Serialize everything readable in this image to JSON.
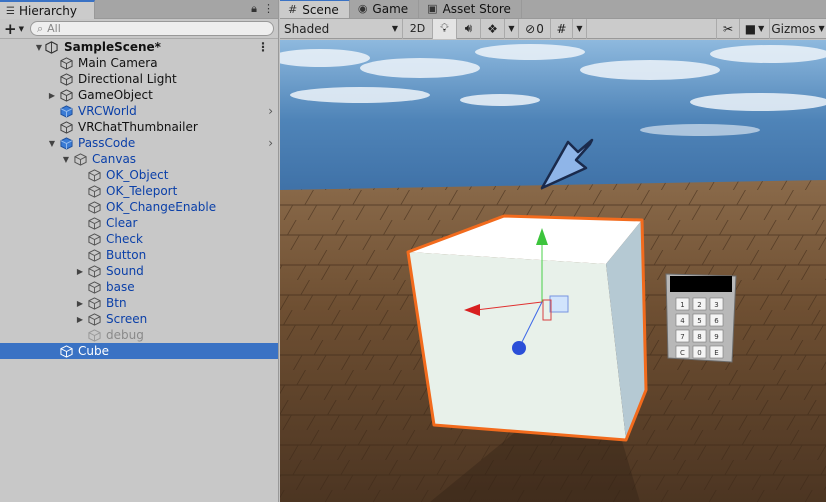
{
  "hierarchy": {
    "tab_label": "Hierarchy",
    "search_placeholder": "All",
    "scene_name": "SampleScene*",
    "items": [
      {
        "label": "Main Camera",
        "indent": 1,
        "arrow": "",
        "style": "normal"
      },
      {
        "label": "Directional Light",
        "indent": 1,
        "arrow": "",
        "style": "normal"
      },
      {
        "label": "GameObject",
        "indent": 1,
        "arrow": "right",
        "style": "normal"
      },
      {
        "label": "VRCWorld",
        "indent": 1,
        "arrow": "",
        "style": "prefab",
        "chevron": true
      },
      {
        "label": "VRChatThumbnailer",
        "indent": 1,
        "arrow": "",
        "style": "normal"
      },
      {
        "label": "PassCode",
        "indent": 1,
        "arrow": "down",
        "style": "prefab",
        "chevron": true
      },
      {
        "label": "Canvas",
        "indent": 2,
        "arrow": "down",
        "style": "prefab-child"
      },
      {
        "label": "OK_Object",
        "indent": 3,
        "arrow": "",
        "style": "prefab-child"
      },
      {
        "label": "OK_Teleport",
        "indent": 3,
        "arrow": "",
        "style": "prefab-child"
      },
      {
        "label": "OK_ChangeEnable",
        "indent": 3,
        "arrow": "",
        "style": "prefab-child"
      },
      {
        "label": "Clear",
        "indent": 3,
        "arrow": "",
        "style": "prefab-child"
      },
      {
        "label": "Check",
        "indent": 3,
        "arrow": "",
        "style": "prefab-child"
      },
      {
        "label": "Button",
        "indent": 3,
        "arrow": "",
        "style": "prefab-child"
      },
      {
        "label": "Sound",
        "indent": 3,
        "arrow": "right",
        "style": "prefab-child"
      },
      {
        "label": "base",
        "indent": 3,
        "arrow": "",
        "style": "prefab-child"
      },
      {
        "label": "Btn",
        "indent": 3,
        "arrow": "right",
        "style": "prefab-child"
      },
      {
        "label": "Screen",
        "indent": 3,
        "arrow": "right",
        "style": "prefab-child"
      },
      {
        "label": "debug",
        "indent": 3,
        "arrow": "",
        "style": "disabled"
      },
      {
        "label": "Cube",
        "indent": 1,
        "arrow": "",
        "style": "selected"
      }
    ]
  },
  "scene": {
    "tabs": [
      {
        "label": "Scene",
        "icon": "grid-icon",
        "active": true
      },
      {
        "label": "Game",
        "icon": "gamepad-icon",
        "active": false
      },
      {
        "label": "Asset Store",
        "icon": "store-icon",
        "active": false
      }
    ],
    "shading_mode": "Shaded",
    "mode_2d": "2D",
    "hidden_count": "0",
    "gizmos_label": "Gizmos",
    "keypad_keys": [
      "1",
      "2",
      "3",
      "4",
      "5",
      "6",
      "7",
      "8",
      "9",
      "C",
      "0",
      "E"
    ]
  },
  "colors": {
    "selection": "#3a72c4",
    "prefab_blue": "#0a3fa8",
    "outline_orange": "#f26b1d"
  }
}
